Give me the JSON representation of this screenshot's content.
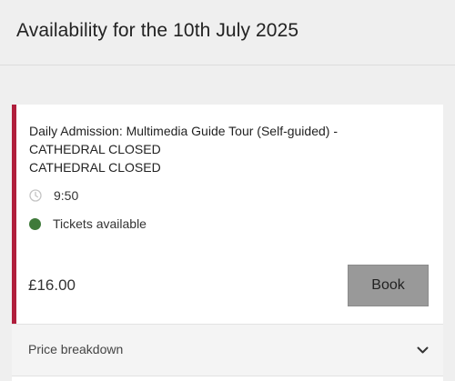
{
  "header": {
    "title": "Availability for the 10th July 2025"
  },
  "session": {
    "title_line1": "Daily Admission: Multimedia Guide Tour (Self-guided) -",
    "title_line2": "CATHEDRAL CLOSED",
    "title_line3": "CATHEDRAL CLOSED",
    "time": "9:50",
    "time_icon": "clock-icon",
    "availability": "Tickets available",
    "availability_color": "#3f7a3a",
    "price": "£16.00",
    "book_label": "Book",
    "accent_color": "#b01e3c"
  },
  "breakdown": {
    "label": "Price breakdown",
    "icon": "chevron-down-icon"
  }
}
